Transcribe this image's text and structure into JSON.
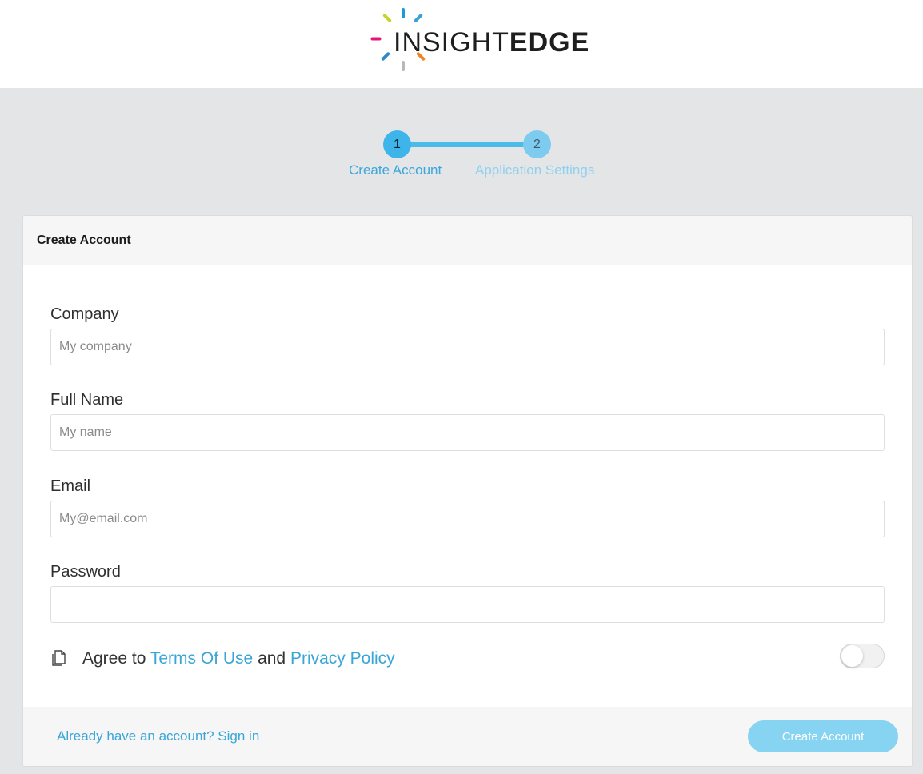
{
  "brand": {
    "logo_light": "INSIGHT",
    "logo_bold": "EDGE",
    "ray_colors": [
      "#1a9ad6",
      "#f08222",
      "#b8b8b8",
      "#2f87c8",
      "#e1157b",
      "#c8d42a",
      "#3aa0d8"
    ]
  },
  "stepper": {
    "steps": [
      {
        "number": "1",
        "label": "Create Account",
        "state": "active"
      },
      {
        "number": "2",
        "label": "Application Settings",
        "state": "upcoming"
      }
    ]
  },
  "card": {
    "title": "Create Account",
    "fields": {
      "company": {
        "label": "Company",
        "placeholder": "My company",
        "value": ""
      },
      "full_name": {
        "label": "Full Name",
        "placeholder": "My name",
        "value": ""
      },
      "email": {
        "label": "Email",
        "placeholder": "My@email.com",
        "value": ""
      },
      "password": {
        "label": "Password",
        "placeholder": "",
        "value": ""
      }
    },
    "agreement": {
      "icon": "document-icon",
      "prefix": "Agree to",
      "terms_link": "Terms Of Use",
      "conjunction": "and",
      "privacy_link": "Privacy Policy",
      "toggle_on": false
    },
    "footer": {
      "signin_text": "Already have an account? Sign in",
      "submit_label": "Create Account"
    }
  },
  "colors": {
    "accent": "#3db5ea",
    "link": "#3aa6d6",
    "button_disabled": "#86d3f2",
    "page_background": "#e4e5e7"
  }
}
